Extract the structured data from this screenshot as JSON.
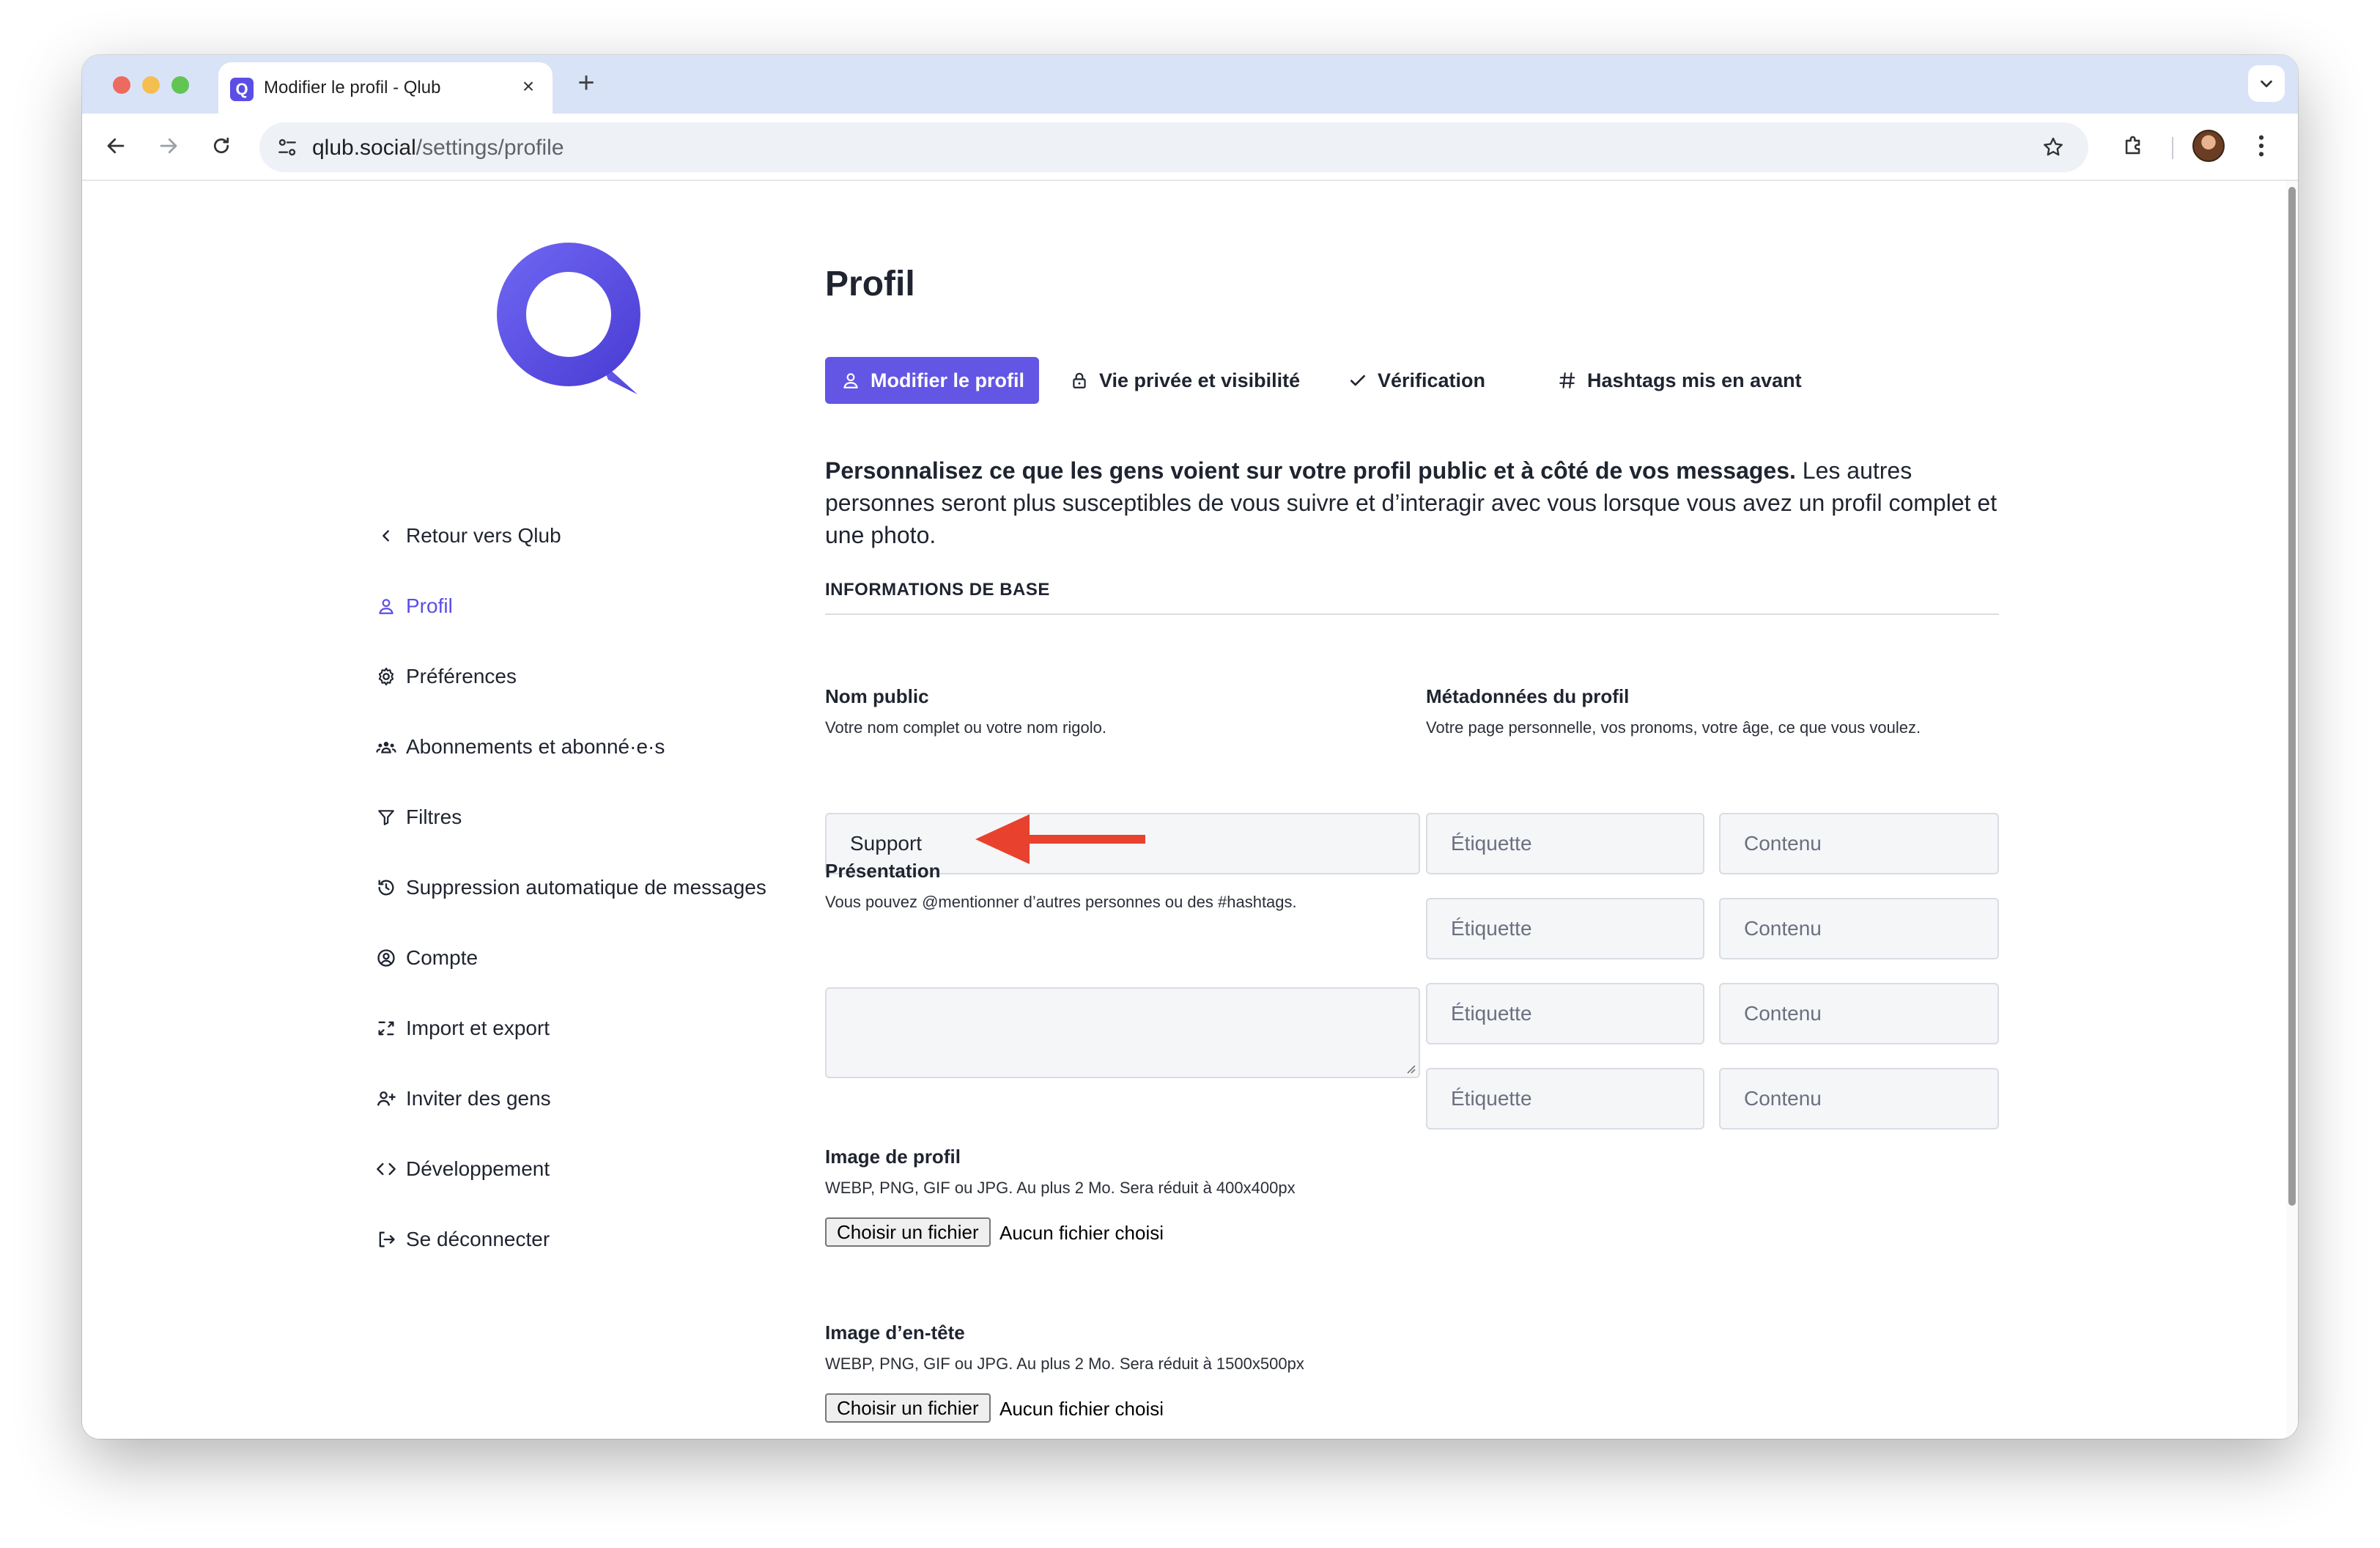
{
  "browser": {
    "tab": {
      "title": "Modifier le profil - Qlub",
      "favicon_letter": "Q",
      "close": "×"
    },
    "new_tab": "+",
    "url": {
      "host": "qlub.social",
      "path": "/settings/profile"
    },
    "colors": {
      "tabstrip": "#d9e3f7",
      "brand": "#5b4ee6"
    }
  },
  "sidebar": {
    "items": [
      {
        "label": "Retour vers Qlub",
        "icon": "chevron-left-icon"
      },
      {
        "label": "Profil",
        "icon": "user-icon",
        "active": true
      },
      {
        "label": "Préférences",
        "icon": "gear-icon"
      },
      {
        "label": "Abonnements et abonné·e·s",
        "icon": "users-icon"
      },
      {
        "label": "Filtres",
        "icon": "filter-icon"
      },
      {
        "label": "Suppression automatique de messages",
        "icon": "history-icon"
      },
      {
        "label": "Compte",
        "icon": "user-circle-icon"
      },
      {
        "label": "Import et export",
        "icon": "import-export-icon"
      },
      {
        "label": "Inviter des gens",
        "icon": "user-plus-icon"
      },
      {
        "label": "Développement",
        "icon": "code-icon"
      },
      {
        "label": "Se déconnecter",
        "icon": "logout-icon"
      }
    ]
  },
  "main": {
    "title": "Profil",
    "tabs": [
      {
        "label": "Modifier le profil",
        "icon": "user-icon",
        "active": true
      },
      {
        "label": "Vie privée et visibilité",
        "icon": "lock-icon"
      },
      {
        "label": "Vérification",
        "icon": "check-icon"
      },
      {
        "label": "Hashtags mis en avant",
        "icon": "hash-icon"
      }
    ],
    "intro_bold": "Personnalisez ce que les gens voient sur votre profil public et à côté de vos messages.",
    "intro_rest": " Les autres personnes seront plus susceptibles de vous suivre et d’interagir avec vous lorsque vous avez un profil complet et une photo.",
    "section_title": "INFORMATIONS DE BASE",
    "display_name": {
      "label": "Nom public",
      "hint": "Votre nom complet ou votre nom rigolo.",
      "value": "Support"
    },
    "bio": {
      "label": "Présentation",
      "hint": "Vous pouvez @mentionner d’autres personnes ou des #hashtags.",
      "value": ""
    },
    "metadata": {
      "label": "Métadonnées du profil",
      "hint": "Votre page personnelle, vos pronoms, votre âge, ce que vous voulez.",
      "label_placeholder": "Étiquette",
      "content_placeholder": "Contenu"
    },
    "avatar_upload": {
      "label": "Image de profil",
      "hint": "WEBP, PNG, GIF ou JPG. Au plus 2 Mo. Sera réduit à 400x400px",
      "button": "Choisir un fichier",
      "status": "Aucun fichier choisi"
    },
    "header_upload": {
      "label": "Image d’en-tête",
      "hint": "WEBP, PNG, GIF ou JPG. Au plus 2 Mo. Sera réduit à 1500x500px",
      "button": "Choisir un fichier",
      "status": "Aucun fichier choisi"
    },
    "colors": {
      "accent": "#6356e5",
      "annotation_arrow": "#e8412e"
    }
  }
}
